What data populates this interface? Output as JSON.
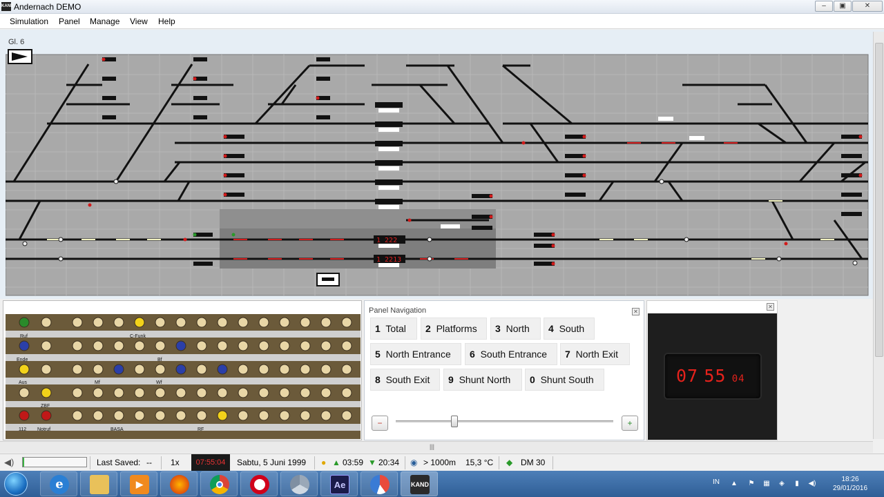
{
  "window": {
    "icon_text": "KAND",
    "title": "Andernach DEMO",
    "minimize": "–",
    "maximize": "▣",
    "close": "✕"
  },
  "menu": {
    "items": [
      "Simulation",
      "Panel",
      "Manage",
      "View",
      "Help"
    ]
  },
  "track_panel": {
    "label": "Gl. 6",
    "train_counters": [
      "1 222",
      "1 2213"
    ]
  },
  "button_panel": {
    "labels": [
      "Ruf",
      "C-Funk",
      "Ende",
      "Bf",
      "Aus",
      "Mf",
      "Wf",
      "ZBF",
      "112",
      "Notruf",
      "BASA",
      "RF"
    ]
  },
  "panel_navigation": {
    "title": "Panel Navigation",
    "close": "✕",
    "buttons": [
      {
        "num": "1",
        "label": "Total"
      },
      {
        "num": "2",
        "label": "Platforms"
      },
      {
        "num": "3",
        "label": "North"
      },
      {
        "num": "4",
        "label": "South"
      },
      {
        "num": "5",
        "label": "North Entrance"
      },
      {
        "num": "6",
        "label": "South Entrance"
      },
      {
        "num": "7",
        "label": "North Exit"
      },
      {
        "num": "8",
        "label": "South Exit"
      },
      {
        "num": "9",
        "label": "Shunt North"
      },
      {
        "num": "0",
        "label": "Shunt South"
      }
    ],
    "zoom_slider": 0.27
  },
  "clock": {
    "close": "✕",
    "hours": "07",
    "minutes": "55",
    "seconds": "04"
  },
  "status": {
    "progress": 0.02,
    "last_saved_label": "Last Saved:",
    "last_saved_value": "--",
    "speed": "1x",
    "sim_time": "07:55:04",
    "date": "Sabtu, 5 Juni 1999",
    "sunrise": "03:59",
    "sunset": "20:34",
    "visibility": "> 1000m",
    "temperature": "15,3 °C",
    "decoder": "DM 30"
  },
  "taskbar": {
    "apps": [
      "internet-explorer",
      "file-explorer",
      "media-player",
      "firefox",
      "chrome",
      "opera",
      "chrome-alt",
      "after-effects",
      "app-circle",
      "kand"
    ],
    "ae_label": "Ae",
    "kand_label": "KAND",
    "language": "IN",
    "time": "18:26",
    "date": "29/01/2016"
  },
  "colors": {
    "accent": "#e5221c",
    "track": "#111111",
    "panel_bg": "#a8a8a8",
    "lamp_yellow": "#f2d21a",
    "lamp_blue": "#2b3fa8",
    "lamp_green": "#2a8a2a",
    "lamp_red": "#c01818"
  }
}
